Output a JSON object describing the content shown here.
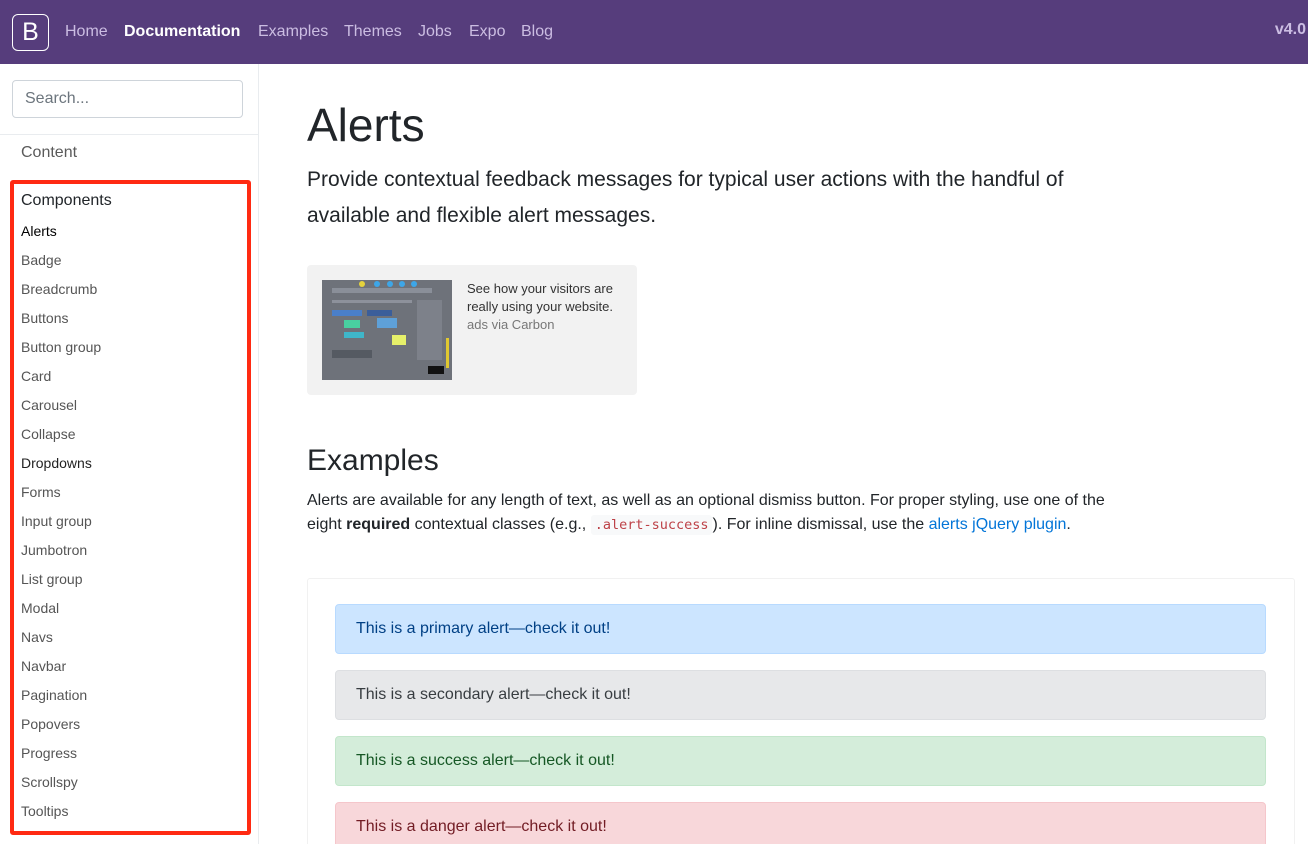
{
  "navbar": {
    "brand": "B",
    "links": [
      "Home",
      "Documentation",
      "Examples",
      "Themes",
      "Jobs",
      "Expo",
      "Blog"
    ],
    "version": "v4.0"
  },
  "sidebar": {
    "search_placeholder": "Search...",
    "content_section": "Content",
    "components_section": "Components",
    "items": [
      "Alerts",
      "Badge",
      "Breadcrumb",
      "Buttons",
      "Button group",
      "Card",
      "Carousel",
      "Collapse",
      "Dropdowns",
      "Forms",
      "Input group",
      "Jumbotron",
      "List group",
      "Modal",
      "Navs",
      "Navbar",
      "Pagination",
      "Popovers",
      "Progress",
      "Scrollspy",
      "Tooltips"
    ]
  },
  "main": {
    "title": "Alerts",
    "lead": "Provide contextual feedback messages for typical user actions with the handful of available and flexible alert messages.",
    "carbon": {
      "text": "See how your visitors are really using your website.",
      "poweredby": "ads via Carbon"
    },
    "examples_heading": "Examples",
    "desc": {
      "part1": "Alerts are available for any length of text, as well as an optional dismiss button. For proper styling, use one of the eight ",
      "bold": "required",
      "part2": " contextual classes (e.g., ",
      "code": ".alert-success",
      "part3": "). For inline dismissal, use the ",
      "link": "alerts jQuery plugin",
      "part4": "."
    },
    "alerts": [
      "This is a primary alert—check it out!",
      "This is a secondary alert—check it out!",
      "This is a success alert—check it out!",
      "This is a danger alert—check it out!"
    ]
  },
  "colors": {
    "navbar_bg": "#563d7c",
    "highlight_border": "#ff2a12",
    "link": "#0275d8"
  }
}
